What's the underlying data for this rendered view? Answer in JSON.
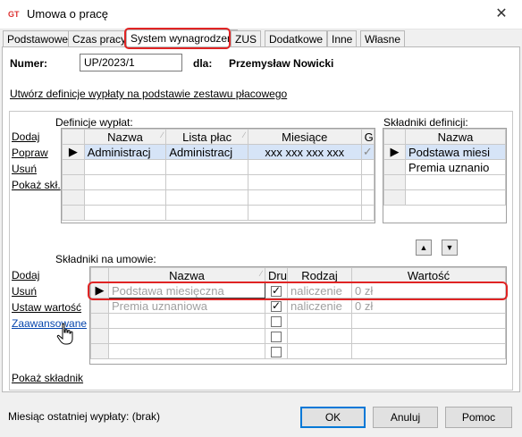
{
  "window": {
    "title": "Umowa o pracę",
    "close_glyph": "✕",
    "icon": "app-logo-icon"
  },
  "tabs": [
    {
      "label": "Podstawowe"
    },
    {
      "label": "Czas pracy"
    },
    {
      "label": "System wynagrodzeń",
      "active": true
    },
    {
      "label": "ZUS"
    },
    {
      "label": "Dodatkowe"
    },
    {
      "label": "Inne"
    },
    {
      "label": "Własne"
    }
  ],
  "header": {
    "number_label": "Numer:",
    "number_value": "UP/2023/1",
    "for_label": "dla:",
    "person": "Przemysław Nowicki"
  },
  "create_link": "Utwórz definicje wypłaty na podstawie zestawu płacowego",
  "definitions": {
    "title": "Definicje wypłat:",
    "actions": [
      "Dodaj",
      "Popraw",
      "Usuń",
      "Pokaż skł."
    ],
    "columns": [
      "Nazwa",
      "Lista płac",
      "Miesiące",
      "G"
    ],
    "rows": [
      {
        "nazwa": "Administracj",
        "lista": "Administracj",
        "miesiace": "xxx xxx xxx xxx",
        "g": "✓"
      }
    ]
  },
  "components_def": {
    "title": "Składniki definicji:",
    "column": "Nazwa",
    "rows": [
      "Podstawa miesi",
      "Premia uznanio"
    ]
  },
  "move_buttons": {
    "up": "▲",
    "down": "▼"
  },
  "contract_components": {
    "title": "Składniki na umowie:",
    "actions": [
      "Dodaj",
      "Usuń",
      "Ustaw wartość",
      "Zaawansowane"
    ],
    "bottom_action": "Pokaż składnik",
    "columns": [
      "Nazwa",
      "Dru",
      "Rodzaj",
      "Wartość"
    ],
    "rows": [
      {
        "nazwa": "Podstawa miesięczna",
        "dru": true,
        "rodzaj": "naliczenie",
        "wartosc": "0 zł"
      },
      {
        "nazwa": "Premia uznaniowa",
        "dru": true,
        "rodzaj": "naliczenie",
        "wartosc": "0 zł"
      }
    ]
  },
  "footer": {
    "status": "Miesiąc ostatniej wypłaty: (brak)",
    "ok": "OK",
    "cancel": "Anuluj",
    "help": "Pomoc"
  },
  "colors": {
    "highlight": "#e02424",
    "link_blue": "#0645ad"
  }
}
